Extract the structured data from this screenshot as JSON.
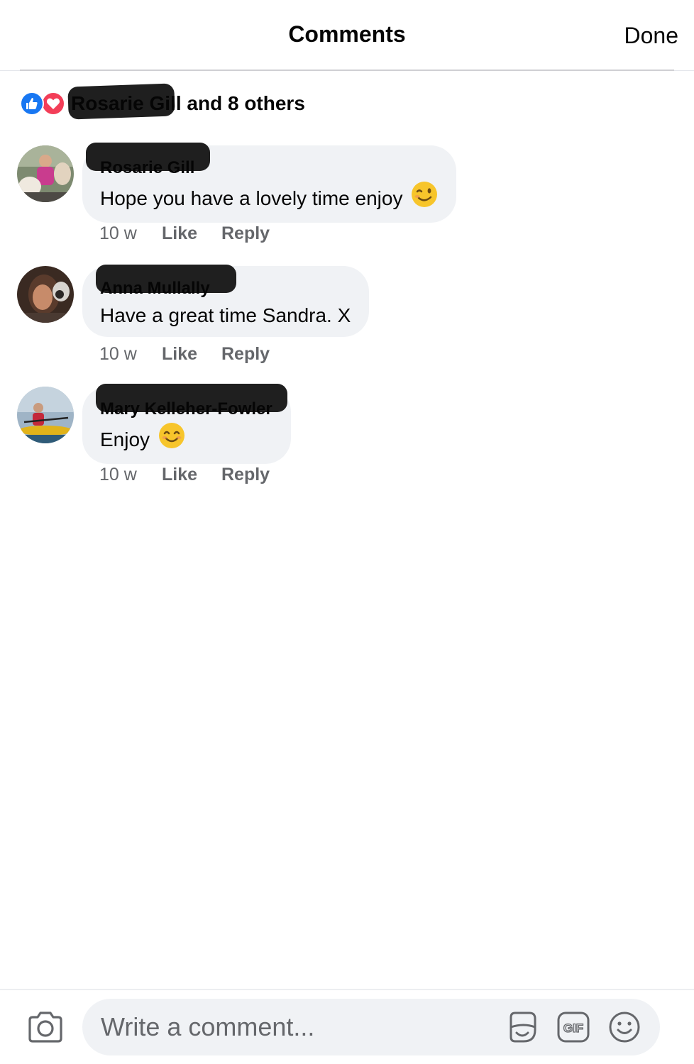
{
  "header": {
    "title": "Comments",
    "done_label": "Done"
  },
  "reactions": {
    "icons": [
      "like-icon",
      "love-icon"
    ],
    "name": "Rosarie Gill",
    "others_text": "and 8 others",
    "like_color": "#1877f2",
    "love_color": "#f33e58"
  },
  "comments": [
    {
      "author": "Rosarie Gill",
      "text": "Hope you have a lovely time  enjoy",
      "emoji": "winking-face-emoji",
      "time": "10 w",
      "like_label": "Like",
      "reply_label": "Reply"
    },
    {
      "author": "Anna Mullally",
      "text": "Have a great time Sandra. X",
      "emoji": "",
      "time": "10 w",
      "like_label": "Like",
      "reply_label": "Reply"
    },
    {
      "author": "Mary Kelleher-Fowler",
      "text": "Enjoy",
      "emoji": "smiling-face-emoji",
      "time": "10 w",
      "like_label": "Like",
      "reply_label": "Reply"
    }
  ],
  "composer": {
    "placeholder": "Write a comment...",
    "tools": [
      "camera-icon",
      "sticker-icon",
      "gif-icon",
      "emoji-icon"
    ],
    "gif_label": "GIF"
  },
  "colors": {
    "bubble": "#f0f2f5",
    "meta_text": "#65676b",
    "primary_text": "#050505"
  }
}
